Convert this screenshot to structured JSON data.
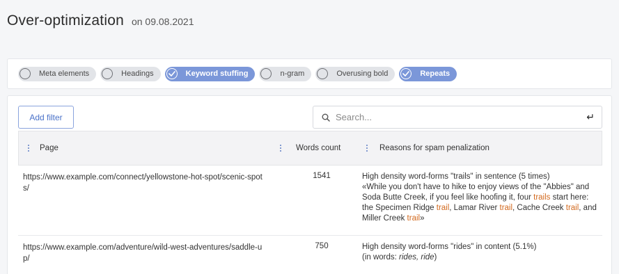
{
  "header": {
    "title": "Over-optimization",
    "date": "on 09.08.2021"
  },
  "filters": [
    {
      "label": "Meta elements",
      "active": false
    },
    {
      "label": "Headings",
      "active": false
    },
    {
      "label": "Keyword stuffing",
      "active": true
    },
    {
      "label": "n-gram",
      "active": false
    },
    {
      "label": "Overusing bold",
      "active": false
    },
    {
      "label": "Repeats",
      "active": true
    }
  ],
  "toolbar": {
    "add_filter_label": "Add filter"
  },
  "search": {
    "placeholder": "Search...",
    "value": "",
    "submit_icon": "↵"
  },
  "table": {
    "columns": {
      "page": "Page",
      "words": "Words count",
      "reasons": "Reasons for spam penalization"
    },
    "rows": [
      {
        "page": "https://www.example.com/connect/yellowstone-hot-spot/scenic-spots/",
        "words": "1541",
        "reason_title": "High density word-forms \"trails\" in sentence (5 times)",
        "quote": [
          {
            "t": "«While you don't have to hike to enjoy views of the \"Abbies\" and Soda Butte Creek, if you feel like hoofing it, four ",
            "hl": false
          },
          {
            "t": "trails",
            "hl": true
          },
          {
            "t": " start here: the Specimen Ridge ",
            "hl": false
          },
          {
            "t": "trail",
            "hl": true
          },
          {
            "t": ", Lamar River ",
            "hl": false
          },
          {
            "t": "trail",
            "hl": true
          },
          {
            "t": ", Cache Creek ",
            "hl": false
          },
          {
            "t": "trail",
            "hl": true
          },
          {
            "t": ", and Miller Creek ",
            "hl": false
          },
          {
            "t": "trail",
            "hl": true
          },
          {
            "t": "»",
            "hl": false
          }
        ]
      },
      {
        "page": "https://www.example.com/adventure/wild-west-adventures/saddle-up/",
        "words": "750",
        "reason_title": "High density word-forms \"rides\" in content (5.1%)",
        "in_words_prefix": "(in words: ",
        "in_words_list": "rides, ride",
        "in_words_suffix": ")"
      }
    ]
  },
  "colors": {
    "accent": "#7b97d9",
    "highlight": "#d2691e",
    "chip_inactive": "#e2e4e8",
    "link_blue": "#4a72c9"
  },
  "icons": {
    "filter_check": "check-icon",
    "search": "search-icon",
    "submit": "enter-icon",
    "column_menu": "kebab-icon"
  }
}
